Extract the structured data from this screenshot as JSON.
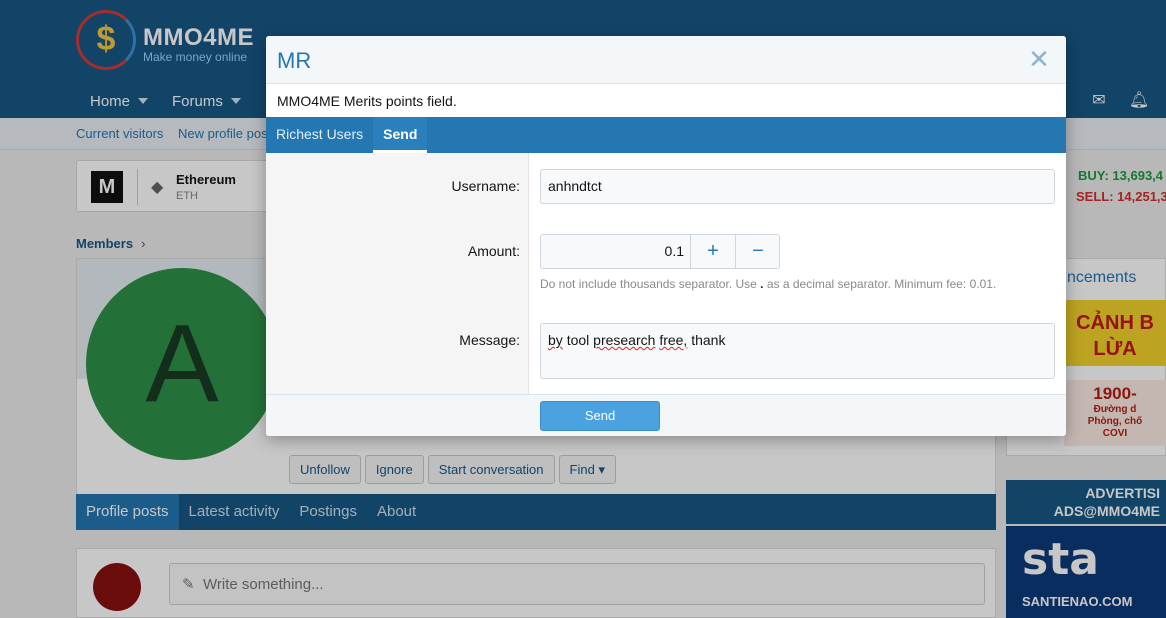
{
  "site": {
    "logo_text": "MMO4ME",
    "logo_sub": "Make money online",
    "nav": [
      {
        "label": "Home"
      },
      {
        "label": "Forums"
      }
    ],
    "subnav": [
      "Current visitors",
      "New profile pos"
    ]
  },
  "ticker": {
    "logo_letter": "M",
    "coin_name": "Ethereum",
    "coin_symbol": "ETH",
    "buy": "BUY: 13,693,4",
    "sell": "SELL: 14,251,3"
  },
  "breadcrumb": {
    "label": "Members",
    "chevron": "›"
  },
  "profile": {
    "avatar_letter": "A",
    "actions": [
      "Unfollow",
      "Ignore",
      "Start conversation",
      "Find"
    ],
    "tabs": [
      "Profile posts",
      "Latest activity",
      "Postings",
      "About"
    ],
    "status_placeholder": "Write something..."
  },
  "sidebar": {
    "announcements_title": "ncements",
    "warn_banner_line1": "CẢNH B",
    "warn_banner_line2": "LỪA",
    "hotline_number": "1900-",
    "hotline_sub1": "Đường d",
    "hotline_sub2": "Phòng, chố",
    "hotline_sub3": "COVI",
    "ads_line1": "ADVERTISI",
    "ads_line2": "ADS@MMO4ME",
    "sta_big": "sta",
    "sta_small": "SANTIENAO.COM"
  },
  "modal": {
    "title": "MR",
    "close_glyph": "✕",
    "description": "MMO4ME Merits points field.",
    "tabs": [
      {
        "label": "Richest Users"
      },
      {
        "label": "Send"
      }
    ],
    "form": {
      "username_label": "Username:",
      "username_value": "anhndtct",
      "amount_label": "Amount:",
      "amount_value": "0.1",
      "plus_glyph": "+",
      "minus_glyph": "−",
      "hint_before": "Do not include thousands separator. Use",
      "hint_dot": ".",
      "hint_after": "as a decimal separator. Minimum fee: 0.01.",
      "message_label": "Message:",
      "message_words": [
        "by",
        "tool",
        "presearch",
        "free,",
        "thank"
      ]
    },
    "send_label": "Send"
  },
  "colors": {
    "header": "#185886",
    "accent": "#2577b1",
    "send_button": "#4aa3e0",
    "buy": "#1c9a3d",
    "sell": "#d12f2f"
  }
}
